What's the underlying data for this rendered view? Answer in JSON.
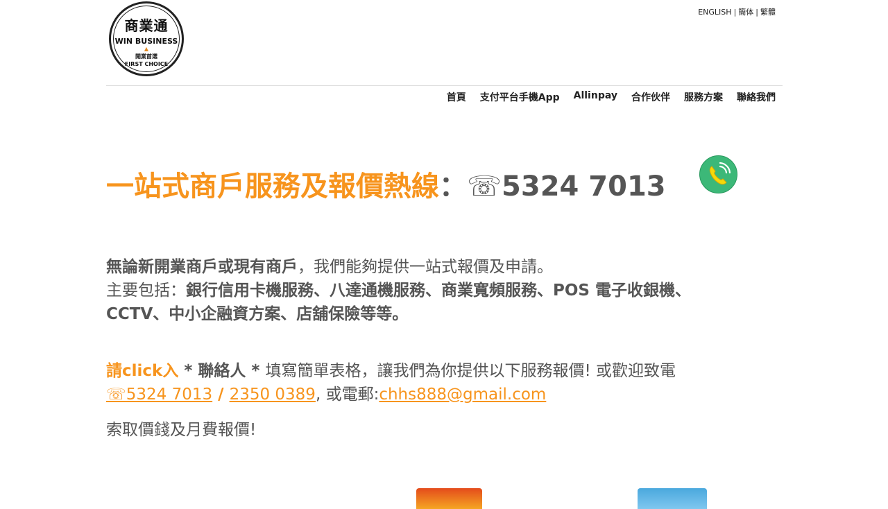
{
  "logo": {
    "cn": "商業通",
    "en": "WIN BUSINESS",
    "cn2": "開業首選",
    "en2": "FIRST CHOICE"
  },
  "lang": [
    "ENGLISH",
    "簡体",
    "繁體"
  ],
  "nav": [
    "首頁",
    "支付平台手機App",
    "Allinpay",
    "合作伙伴",
    "服務方案",
    "聯絡我們"
  ],
  "hotline": {
    "title": "一站式商戶服務及報價熱線",
    "colon": "：",
    "phone_icon": "☏",
    "phone": "5324 7013"
  },
  "intro": {
    "line1_bold": "無論新開業商戶或現有商戶",
    "line1_rest": "，我們能夠提供一站式報價及申請。",
    "line2_prefix": "主要包括：",
    "line2_bold": "銀行信用卡機服務、八達通機服務、商業寬頻服務、POS 電子收銀機、",
    "line3_bold": "CCTV、中小企融資方案、店舖保險等等。"
  },
  "cta": {
    "click": "請click入",
    "contact": " * 聯絡人 * ",
    "text": "填寫簡單表格，讓我們為你提供以下服務報價! 或歡迎致電",
    "phone1": "☏5324 7013",
    "slash": " / ",
    "phone2": "2350 0389",
    "email_prefix": ", 或電郵:",
    "email": "chhs888@gmail.com",
    "line3": "索取價錢及月費報價!"
  },
  "colors": {
    "accent": "#f7941d",
    "text": "#555555",
    "badge": "#3cb878"
  }
}
